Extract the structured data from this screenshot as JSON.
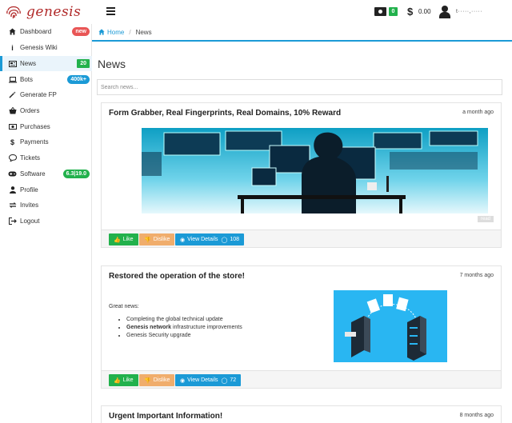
{
  "header": {
    "brand": "genesis",
    "wallet_badge": "0",
    "balance": "0.00",
    "username": "t·····,·····"
  },
  "sidebar": {
    "items": [
      {
        "label": "Dashboard",
        "icon": "dashboard-icon",
        "badge": "new"
      },
      {
        "label": "Genesis Wiki",
        "icon": "info-icon",
        "badge": ""
      },
      {
        "label": "News",
        "icon": "news-icon",
        "badge": "20"
      },
      {
        "label": "Bots",
        "icon": "laptop-icon",
        "badge": "400k+"
      },
      {
        "label": "Generate FP",
        "icon": "wand-icon",
        "badge": ""
      },
      {
        "label": "Orders",
        "icon": "basket-icon",
        "badge": ""
      },
      {
        "label": "Purchases",
        "icon": "money-icon",
        "badge": ""
      },
      {
        "label": "Payments",
        "icon": "dollar-icon",
        "badge": ""
      },
      {
        "label": "Tickets",
        "icon": "chat-icon",
        "badge": ""
      },
      {
        "label": "Software",
        "icon": "gamepad-icon",
        "badge": "6.3|19.0"
      },
      {
        "label": "Profile",
        "icon": "user-icon",
        "badge": ""
      },
      {
        "label": "Invites",
        "icon": "refresh-icon",
        "badge": ""
      },
      {
        "label": "Logout",
        "icon": "logout-icon",
        "badge": ""
      }
    ]
  },
  "breadcrumb": {
    "home": "Home",
    "sep": "/",
    "current": "News"
  },
  "main": {
    "title": "News",
    "search_placeholder": "Search news..."
  },
  "news": [
    {
      "title": "Form Grabber, Real Fingerprints, Real Domains, 10% Reward",
      "time": "a month ago",
      "read": "read",
      "like": "Like",
      "dislike": "Dislike",
      "view": "View Details",
      "comments": "108"
    },
    {
      "title": "Restored the operation of the store!",
      "time": "7 months ago",
      "intro": "Great news:",
      "bullets": {
        "b1": "Completing the global technical update",
        "b2_bold": "Genesis network",
        "b2_rest": " infrastructure improvements",
        "b3": "Genesis Security upgrade"
      },
      "like": "Like",
      "dislike": "Dislike",
      "view": "View Details",
      "comments": "72"
    },
    {
      "title": "Urgent Important Information!",
      "time": "8 months ago"
    }
  ],
  "colors": {
    "accent": "#1b9ad6",
    "brand": "#b12a2a",
    "like": "#22b14c",
    "dislike": "#f0ad6c"
  }
}
